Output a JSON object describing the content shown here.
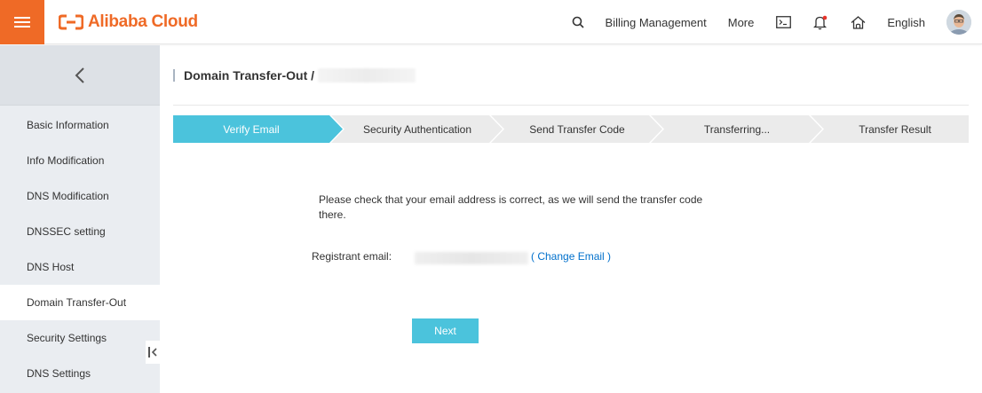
{
  "header": {
    "brand": "Alibaba Cloud",
    "links": {
      "billing": "Billing Management",
      "more": "More",
      "language": "English"
    },
    "icons": [
      "search-icon",
      "terminal-icon",
      "bell-icon",
      "home-icon"
    ],
    "colors": {
      "brand": "#ef6a26",
      "notification_dot": "#e8332a"
    }
  },
  "sidebar": {
    "items": [
      {
        "label": "Basic Information"
      },
      {
        "label": "Info Modification"
      },
      {
        "label": "DNS Modification"
      },
      {
        "label": "DNSSEC setting"
      },
      {
        "label": "DNS Host"
      },
      {
        "label": "Domain Transfer-Out",
        "active": true
      },
      {
        "label": "Security Settings"
      },
      {
        "label": "DNS Settings"
      }
    ]
  },
  "main": {
    "breadcrumb": "Domain Transfer-Out /",
    "steps": [
      {
        "label": "Verify Email",
        "active": true
      },
      {
        "label": "Security Authentication"
      },
      {
        "label": "Send Transfer Code"
      },
      {
        "label": "Transferring..."
      },
      {
        "label": "Transfer Result"
      }
    ],
    "message": "Please check that your email address is correct, as we will send the transfer code there.",
    "registrant_label": "Registrant email:",
    "change_email": "( Change Email )",
    "next_label": "Next",
    "colors": {
      "active_step": "#4bc3dc",
      "inactive_step": "#ebebeb",
      "link": "#0070cc"
    }
  }
}
